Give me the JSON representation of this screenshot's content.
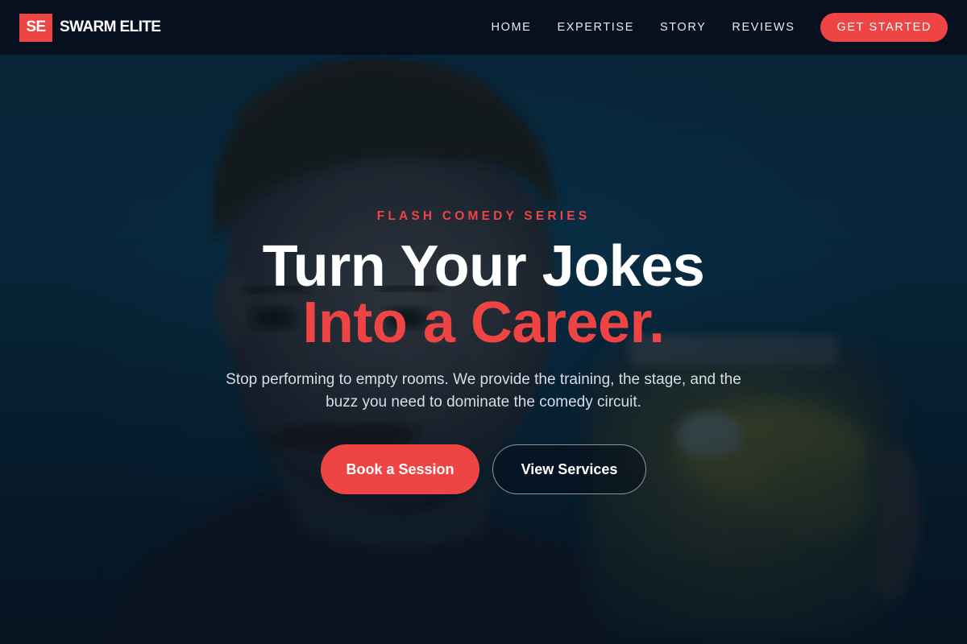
{
  "brand": {
    "mark": "SE",
    "name": "SWARM ELITE"
  },
  "nav": {
    "items": [
      {
        "label": "HOME"
      },
      {
        "label": "EXPERTISE"
      },
      {
        "label": "STORY"
      },
      {
        "label": "REVIEWS"
      }
    ],
    "cta_label": "GET STARTED"
  },
  "hero": {
    "eyebrow": "FLASH COMEDY SERIES",
    "headline_line1": "Turn Your Jokes",
    "headline_line2": "Into a Career.",
    "subcopy": "Stop performing to empty rooms. We provide the training, the stage, and the buzz you need to dominate the comedy circuit.",
    "primary_button": "Book a Session",
    "secondary_button": "View Services"
  },
  "colors": {
    "accent": "#ef4444",
    "navbar_bg": "#06101f",
    "hero_bg": "#093650",
    "text_primary": "#ffffff",
    "text_muted": "#d7dde6"
  }
}
